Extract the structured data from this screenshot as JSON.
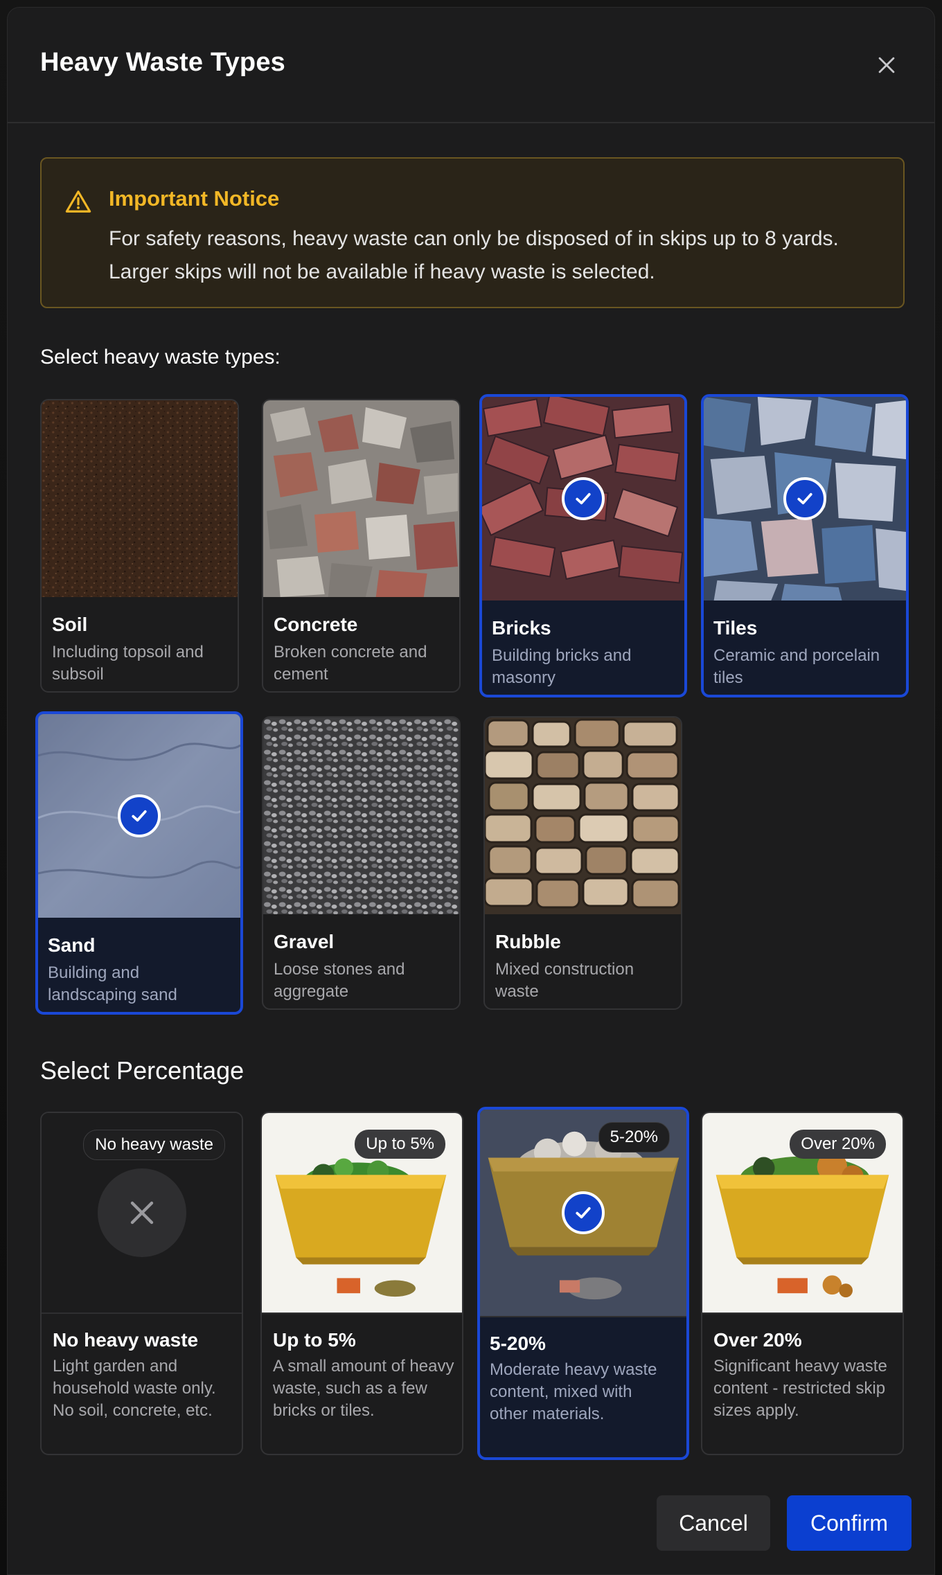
{
  "modal": {
    "title": "Heavy Waste Types",
    "close_icon": "close-icon"
  },
  "notice": {
    "icon": "warning-icon",
    "title": "Important Notice",
    "text": "For safety reasons, heavy waste can only be disposed of in skips up to 8 yards. Larger skips will not be available if heavy waste is selected."
  },
  "types_section": {
    "label": "Select heavy waste types:",
    "items": [
      {
        "name": "Soil",
        "desc": "Including topsoil and subsoil",
        "selected": false
      },
      {
        "name": "Concrete",
        "desc": "Broken concrete and cement",
        "selected": false
      },
      {
        "name": "Bricks",
        "desc": "Building bricks and masonry",
        "selected": true
      },
      {
        "name": "Tiles",
        "desc": "Ceramic and porcelain tiles",
        "selected": true
      },
      {
        "name": "Sand",
        "desc": "Building and landscaping sand",
        "selected": true
      },
      {
        "name": "Gravel",
        "desc": "Loose stones and aggregate",
        "selected": false
      },
      {
        "name": "Rubble",
        "desc": "Mixed construction waste",
        "selected": false
      }
    ]
  },
  "percentage_section": {
    "label": "Select Percentage",
    "items": [
      {
        "badge": "No heavy waste",
        "name": "No heavy waste",
        "desc": "Light garden and household waste only. No soil, concrete, etc.",
        "selected": false
      },
      {
        "badge": "Up to 5%",
        "name": "Up to 5%",
        "desc": "A small amount of heavy waste, such as a few bricks or tiles.",
        "selected": false
      },
      {
        "badge": "5-20%",
        "name": "5-20%",
        "desc": "Moderate heavy waste content, mixed with other materials.",
        "selected": true
      },
      {
        "badge": "Over 20%",
        "name": "Over 20%",
        "desc": "Significant heavy waste content - restricted skip sizes apply.",
        "selected": false
      }
    ]
  },
  "footer": {
    "cancel_label": "Cancel",
    "confirm_label": "Confirm"
  },
  "colors": {
    "accent": "#0b3fd0",
    "selected_border": "#1a48d6",
    "warning": "#f2b726",
    "skip_yellow": "#d9a920"
  }
}
